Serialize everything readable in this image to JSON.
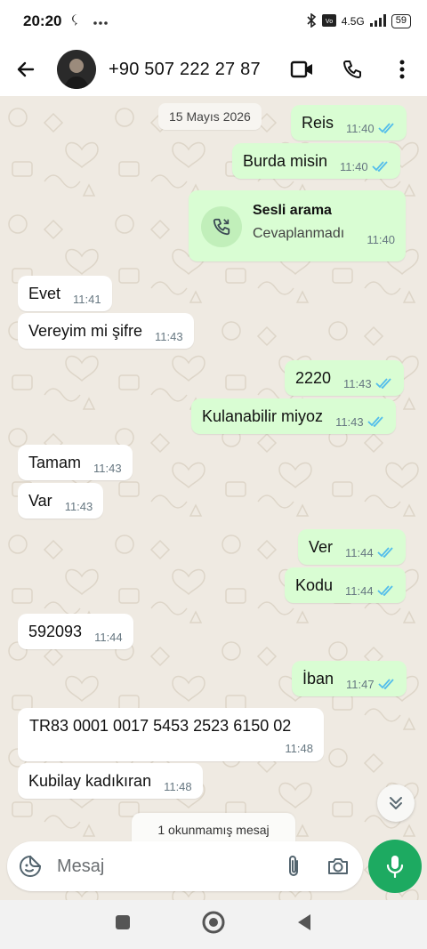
{
  "status_bar": {
    "time": "20:20",
    "network": "4.5G",
    "battery": "59"
  },
  "header": {
    "contact": "+90 507 222 27 87"
  },
  "chat": {
    "date": "15 Mayıs 2026",
    "messages": [
      {
        "direction": "out",
        "text": "Reis",
        "time": "11:40",
        "read": true
      },
      {
        "direction": "out",
        "text": "Burda misin",
        "time": "11:40",
        "read": true
      },
      {
        "direction": "in",
        "text": "Evet",
        "time": "11:41"
      },
      {
        "direction": "in",
        "text": "Vereyim mi şifre",
        "time": "11:43"
      },
      {
        "direction": "out",
        "text": "2220",
        "time": "11:43",
        "read": true
      },
      {
        "direction": "out",
        "text": "Kulanabilir miyoz",
        "time": "11:43",
        "read": true
      },
      {
        "direction": "in",
        "text": "Tamam",
        "time": "11:43"
      },
      {
        "direction": "in",
        "text": "Var",
        "time": "11:43"
      },
      {
        "direction": "out",
        "text": "Ver",
        "time": "11:44",
        "read": true
      },
      {
        "direction": "out",
        "text": "Kodu",
        "time": "11:44",
        "read": true
      },
      {
        "direction": "in",
        "text": "592093",
        "time": "11:44"
      },
      {
        "direction": "out",
        "text": "İban",
        "time": "11:47",
        "read": true
      },
      {
        "direction": "in",
        "text": "TR83 0001 0017 5453 2523 6150 02",
        "time": "11:48"
      },
      {
        "direction": "in",
        "text": "Kubilay kadıkıran",
        "time": "11:48"
      }
    ],
    "call": {
      "title": "Sesli arama",
      "status": "Cevaplanmadı",
      "time": "11:40"
    },
    "unread_label": "1 okunmamış mesaj"
  },
  "composer": {
    "placeholder": "Mesaj"
  },
  "colors": {
    "outgoing_bubble": "#d9fdd3",
    "incoming_bubble": "#ffffff",
    "chat_background": "#efeae2",
    "read_ticks": "#53bdeb",
    "mic_button": "#1daa61"
  }
}
